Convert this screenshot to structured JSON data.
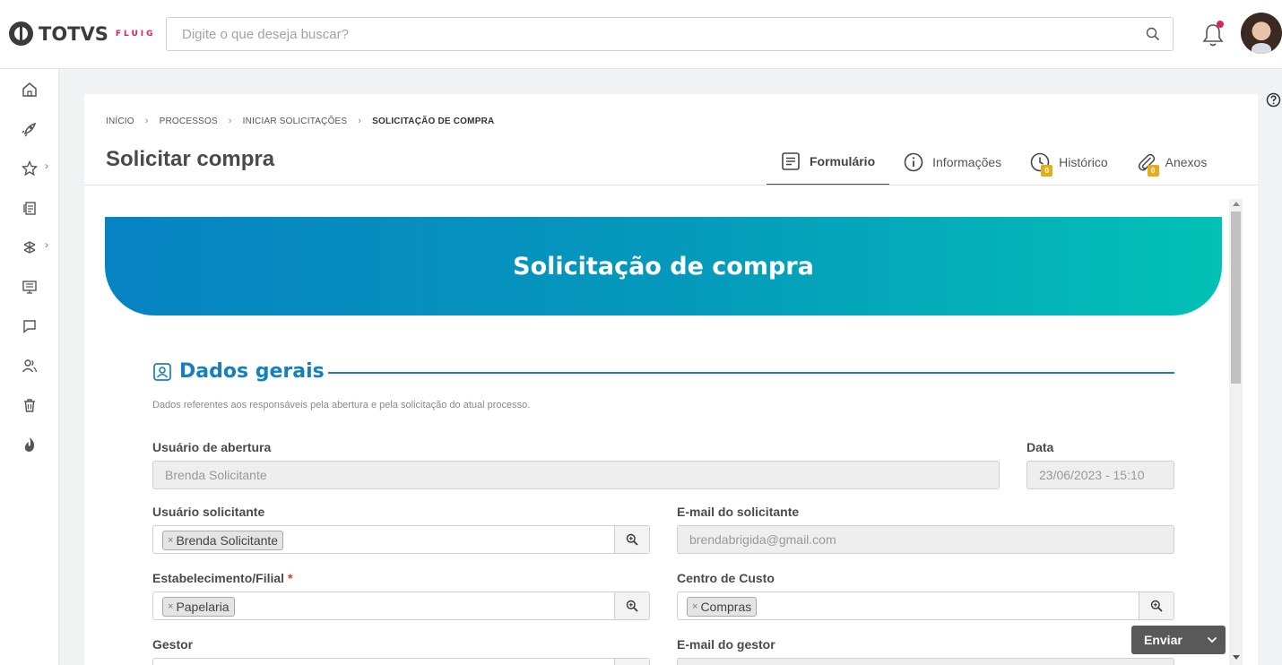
{
  "app": {
    "brand": "TOTVS",
    "brand_sub": "FLUIG",
    "accent": "#e0205a"
  },
  "search": {
    "placeholder": "Digite o que deseja buscar?"
  },
  "sidebar": {
    "items": [
      {
        "icon": "home-icon"
      },
      {
        "icon": "rocket-icon"
      },
      {
        "icon": "star-icon",
        "has_submenu": true
      },
      {
        "icon": "documents-icon"
      },
      {
        "icon": "workflow-icon",
        "has_submenu": true
      },
      {
        "icon": "dashboard-icon"
      },
      {
        "icon": "chat-icon"
      },
      {
        "icon": "users-icon"
      },
      {
        "icon": "trash-icon"
      },
      {
        "icon": "fluig-flame-icon"
      }
    ]
  },
  "breadcrumb": {
    "items": [
      "INÍCIO",
      "PROCESSOS",
      "INICIAR SOLICITAÇÕES"
    ],
    "current": "SOLICITAÇÃO DE COMPRA"
  },
  "page": {
    "title": "Solicitar compra"
  },
  "tabs": [
    {
      "label": "Formulário",
      "active": true
    },
    {
      "label": "Informações"
    },
    {
      "label": "Histórico",
      "badge": "0"
    },
    {
      "label": "Anexos",
      "badge": "0"
    }
  ],
  "form": {
    "banner_title": "Solicitação de compra",
    "banner_colors": [
      "#0683c2",
      "#02c1b6"
    ],
    "section": {
      "title": "Dados gerais",
      "description": "Dados referentes aos responsáveis pela abertura e pela solicitação do atual processo.",
      "color": "#1580bf"
    },
    "fields": {
      "usuario_abertura": {
        "label": "Usuário de abertura",
        "value": "Brenda Solicitante"
      },
      "data": {
        "label": "Data",
        "value": "23/06/2023 - 15:10"
      },
      "usuario_solicitante": {
        "label": "Usuário solicitante",
        "chip": "Brenda Solicitante"
      },
      "email_solicitante": {
        "label": "E-mail do solicitante",
        "value": "brendabrigida@gmail.com"
      },
      "estabelecimento": {
        "label": "Estabelecimento/Filial",
        "required_mark": "*",
        "chip": "Papelaria"
      },
      "centro_custo": {
        "label": "Centro de Custo",
        "chip": "Compras"
      },
      "gestor": {
        "label": "Gestor"
      },
      "email_gestor": {
        "label": "E-mail do gestor"
      }
    },
    "chip_remove": "×"
  },
  "actions": {
    "send_label": "Enviar"
  }
}
